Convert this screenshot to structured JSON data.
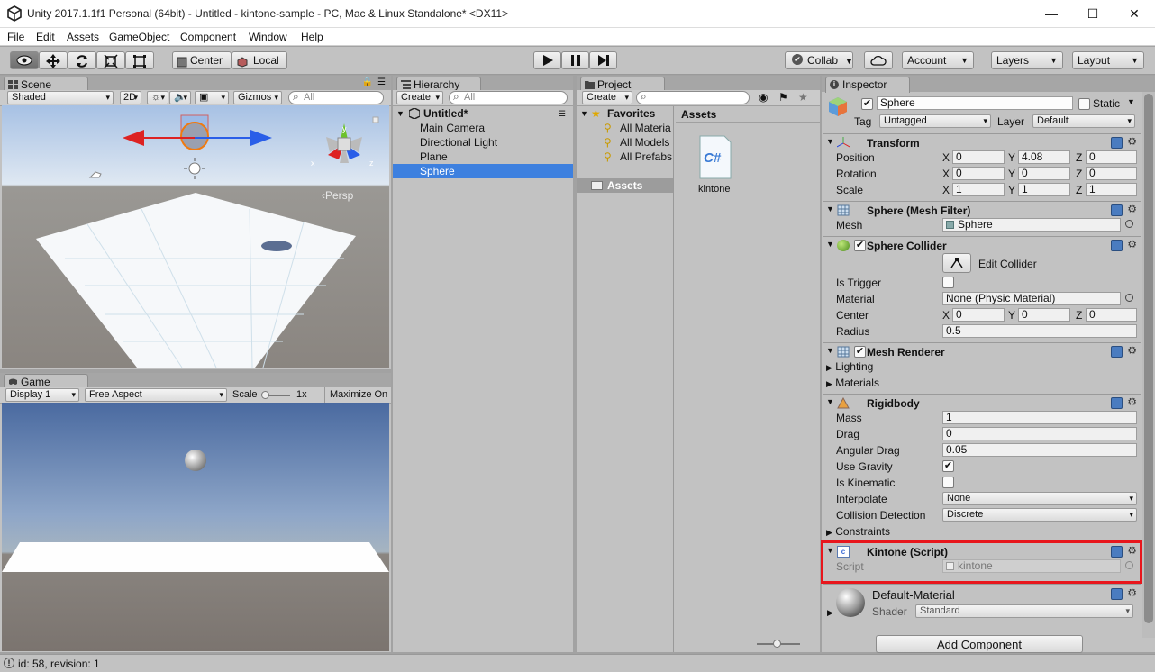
{
  "window": {
    "title": "Unity 2017.1.1f1 Personal (64bit) - Untitled - kintone-sample - PC, Mac & Linux Standalone* <DX11>",
    "minimize": "—",
    "maximize": "☐",
    "close": "✕"
  },
  "menu": [
    "File",
    "Edit",
    "Assets",
    "GameObject",
    "Component",
    "Window",
    "Help"
  ],
  "toolbar": {
    "center": "Center",
    "local": "Local",
    "collab": "Collab",
    "account": "Account",
    "layers": "Layers",
    "layout": "Layout"
  },
  "scene": {
    "tab": "Scene",
    "shading": "Shaded",
    "mode2d": "2D",
    "gizmos": "Gizmos",
    "search_placeholder": "All",
    "persp": "‹Persp",
    "axis_x": "x",
    "axis_y": "y",
    "axis_z": "z"
  },
  "game": {
    "tab": "Game",
    "display": "Display 1",
    "aspect": "Free Aspect",
    "scale_label": "Scale",
    "scale_value": "1x",
    "maximize": "Maximize On"
  },
  "hierarchy": {
    "tab": "Hierarchy",
    "create": "Create",
    "search_placeholder": "All",
    "scene_name": "Untitled*",
    "items": [
      "Main Camera",
      "Directional Light",
      "Plane",
      "Sphere"
    ]
  },
  "project": {
    "tab": "Project",
    "create": "Create",
    "favorites": "Favorites",
    "favorite_items": [
      "All Materia",
      "All Models",
      "All Prefabs"
    ],
    "assets_folder": "Assets",
    "assets_header": "Assets",
    "asset_name": "kintone",
    "asset_icon_text": "C#"
  },
  "inspector": {
    "tab": "Inspector",
    "object_name": "Sphere",
    "static": "Static",
    "tag_label": "Tag",
    "tag_value": "Untagged",
    "layer_label": "Layer",
    "layer_value": "Default",
    "transform": {
      "title": "Transform",
      "position": "Position",
      "rotation": "Rotation",
      "scale": "Scale",
      "px": "0",
      "py": "4.08",
      "pz": "0",
      "rx": "0",
      "ry": "0",
      "rz": "0",
      "sx": "1",
      "sy": "1",
      "sz": "1"
    },
    "meshfilter": {
      "title": "Sphere (Mesh Filter)",
      "mesh_label": "Mesh",
      "mesh_value": "Sphere"
    },
    "collider": {
      "title": "Sphere Collider",
      "edit": "Edit Collider",
      "is_trigger": "Is Trigger",
      "material_label": "Material",
      "material_value": "None (Physic Material)",
      "center": "Center",
      "cx": "0",
      "cy": "0",
      "cz": "0",
      "radius_label": "Radius",
      "radius_value": "0.5"
    },
    "renderer": {
      "title": "Mesh Renderer",
      "lighting": "Lighting",
      "materials": "Materials"
    },
    "rigidbody": {
      "title": "Rigidbody",
      "mass": "Mass",
      "mass_v": "1",
      "drag": "Drag",
      "drag_v": "0",
      "angular": "Angular Drag",
      "angular_v": "0.05",
      "gravity": "Use Gravity",
      "kinematic": "Is Kinematic",
      "interpolate": "Interpolate",
      "interpolate_v": "None",
      "collision": "Collision Detection",
      "collision_v": "Discrete",
      "constraints": "Constraints"
    },
    "script": {
      "title": "Kintone (Script)",
      "label": "Script",
      "value": "kintone"
    },
    "material": {
      "name": "Default-Material",
      "shader_label": "Shader",
      "shader_value": "Standard"
    },
    "add_component": "Add Component",
    "x": "X",
    "y": "Y",
    "z": "Z",
    "check": "✔"
  },
  "status": "id: 58, revision: 1",
  "colors": {
    "selection": "#3d80df",
    "highlight_border": "#e8161c",
    "panel": "#c2c2c2"
  }
}
